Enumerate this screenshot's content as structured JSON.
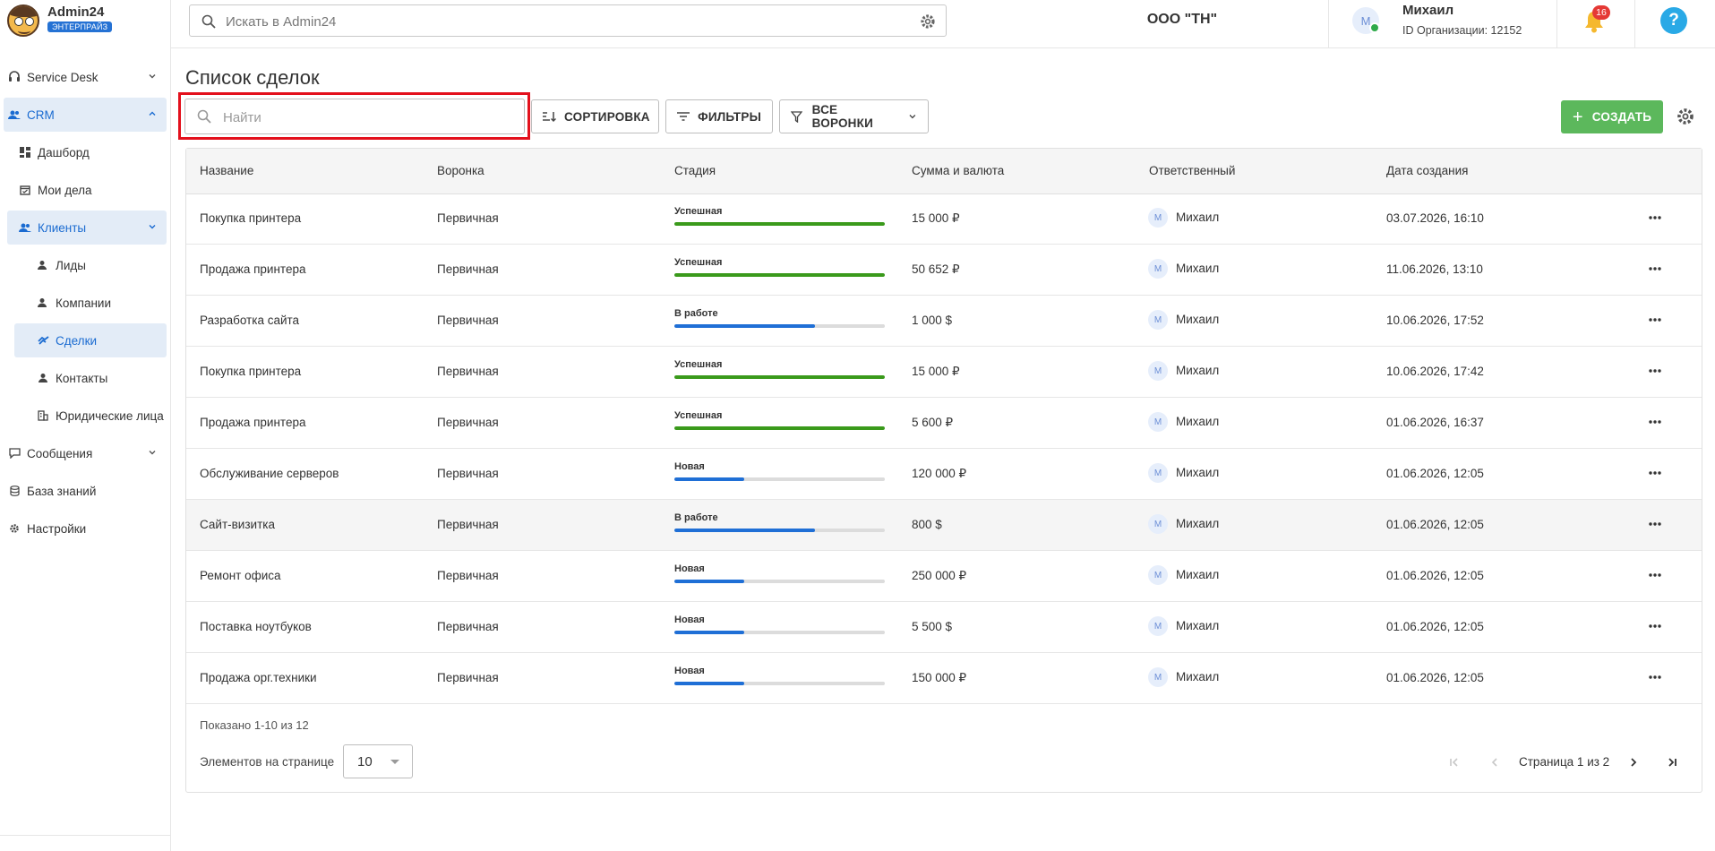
{
  "app": {
    "name": "Admin24",
    "plan": "ЭНТЕРПРАЙЗ"
  },
  "search": {
    "placeholder": "Искать в Admin24"
  },
  "org_name": "ООО \"ТН\"",
  "user": {
    "name": "Михаил",
    "org_id": "ID Организации: 12152",
    "initial": "М",
    "notifications": "16"
  },
  "help_label": "?",
  "sidebar": {
    "items": [
      {
        "label": "Service Desk",
        "icon": "headset-icon"
      },
      {
        "label": "CRM",
        "icon": "people-icon"
      },
      {
        "label": "Дашборд",
        "icon": "dashboard-icon"
      },
      {
        "label": "Мои дела",
        "icon": "calendar-check-icon"
      },
      {
        "label": "Клиенты",
        "icon": "people-icon"
      },
      {
        "label": "Лиды",
        "icon": "person-icon"
      },
      {
        "label": "Компании",
        "icon": "person-icon"
      },
      {
        "label": "Сделки",
        "icon": "handshake-icon"
      },
      {
        "label": "Контакты",
        "icon": "person-icon"
      },
      {
        "label": "Юридические лица",
        "icon": "building-icon"
      },
      {
        "label": "Сообщения",
        "icon": "chat-icon"
      },
      {
        "label": "База знаний",
        "icon": "database-icon"
      },
      {
        "label": "Настройки",
        "icon": "gear-icon"
      }
    ]
  },
  "page": {
    "title": "Список сделок",
    "search_placeholder": "Найти",
    "sort_label": "СОРТИРОВКА",
    "filters_label": "ФИЛЬТРЫ",
    "funnels_label": "ВСЕ ВОРОНКИ",
    "create_label": "СОЗДАТЬ",
    "create_plus": "+"
  },
  "table": {
    "columns": [
      "Название",
      "Воронка",
      "Стадия",
      "Сумма и валюта",
      "Ответственный",
      "Дата создания"
    ],
    "rows": [
      {
        "name": "Покупка принтера",
        "funnel": "Первичная",
        "stage": "Успешная",
        "sum": "15 000 ₽",
        "resp": "Михаил",
        "date": "03.07.2026, 16:10"
      },
      {
        "name": "Продажа принтера",
        "funnel": "Первичная",
        "stage": "Успешная",
        "sum": "50 652 ₽",
        "resp": "Михаил",
        "date": "11.06.2026, 13:10"
      },
      {
        "name": "Разработка сайта",
        "funnel": "Первичная",
        "stage": "В работе",
        "sum": "1 000 $",
        "resp": "Михаил",
        "date": "10.06.2026, 17:52"
      },
      {
        "name": "Покупка принтера",
        "funnel": "Первичная",
        "stage": "Успешная",
        "sum": "15 000 ₽",
        "resp": "Михаил",
        "date": "10.06.2026, 17:42"
      },
      {
        "name": "Продажа принтера",
        "funnel": "Первичная",
        "stage": "Успешная",
        "sum": "5 600 ₽",
        "resp": "Михаил",
        "date": "01.06.2026, 16:37"
      },
      {
        "name": "Обслуживание серверов",
        "funnel": "Первичная",
        "stage": "Новая",
        "sum": "120 000 ₽",
        "resp": "Михаил",
        "date": "01.06.2026, 12:05"
      },
      {
        "name": "Сайт-визитка",
        "funnel": "Первичная",
        "stage": "В работе",
        "sum": "800 $",
        "resp": "Михаил",
        "date": "01.06.2026, 12:05"
      },
      {
        "name": "Ремонт офиса",
        "funnel": "Первичная",
        "stage": "Новая",
        "sum": "250 000 ₽",
        "resp": "Михаил",
        "date": "01.06.2026, 12:05"
      },
      {
        "name": "Поставка ноутбуков",
        "funnel": "Первичная",
        "stage": "Новая",
        "sum": "5 500 $",
        "resp": "Михаил",
        "date": "01.06.2026, 12:05"
      },
      {
        "name": "Продажа орг.техники",
        "funnel": "Первичная",
        "stage": "Новая",
        "sum": "150 000 ₽",
        "resp": "Михаил",
        "date": "01.06.2026, 12:05"
      }
    ]
  },
  "stages": {
    "Успешная": {
      "progress": 1.0,
      "color": "#3a9a1b"
    },
    "В работе": {
      "progress": 0.67,
      "color": "#1f6fd6"
    },
    "Новая": {
      "progress": 0.33,
      "color": "#1f6fd6"
    }
  },
  "pagination": {
    "shown": "Показано 1-10 из 12",
    "per_page_label": "Элементов на странице",
    "per_page_value": "10",
    "page_text": "Страница 1 из 2"
  },
  "colors": {
    "accent": "#1a6bd1",
    "create": "#5cb85c",
    "highlight": "#e3101c",
    "badge": "#e53935"
  }
}
